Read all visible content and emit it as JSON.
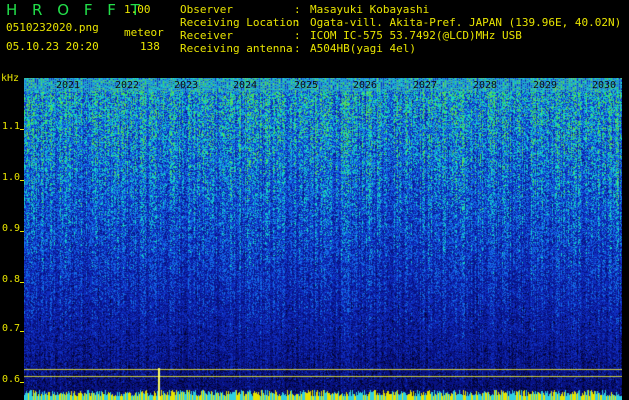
{
  "header": {
    "logo": "H R O F F T",
    "version": "1.00",
    "file_name": "0510232020.png",
    "datetime": "05.10.23 20:20",
    "meteor_label": "meteor",
    "meteor_count": "138"
  },
  "info": [
    {
      "key": "Observer",
      "value": "Masayuki Kobayashi"
    },
    {
      "key": "Receiving Location",
      "value": "Ogata-vill. Akita-Pref. JAPAN (139.96E, 40.02N)"
    },
    {
      "key": "Receiver",
      "value": "ICOM IC-575 53.7492(@LCD)MHz USB"
    },
    {
      "key": "Receiving antenna",
      "value": "A504HB(yagi 4el)"
    }
  ],
  "axis": {
    "unit": "kHz",
    "y_labels": [
      "1.1",
      "1.0",
      "0.9",
      "0.8",
      "0.7",
      "0.6"
    ],
    "x_labels": [
      "2021",
      "2022",
      "2023",
      "2024",
      "2025",
      "2026",
      "2027",
      "2028",
      "2029",
      "2030"
    ]
  },
  "colors": {
    "label": "#e8e400",
    "logo": "#22e04a"
  }
}
